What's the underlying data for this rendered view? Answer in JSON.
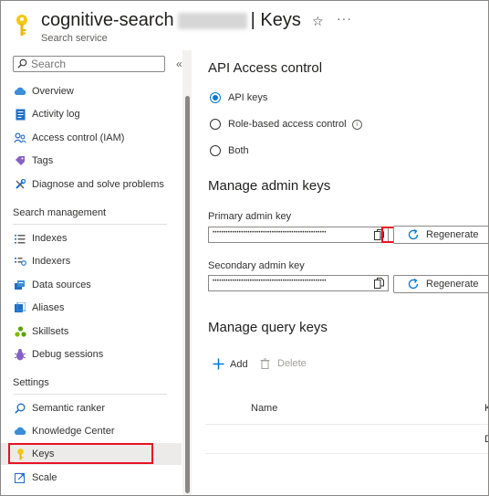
{
  "header": {
    "title_prefix": "cognitive-search",
    "title_suffix": "| Keys",
    "subtitle": "Search service",
    "star_icon": "star-icon",
    "more_icon": "more-icon",
    "more_glyph": "···"
  },
  "sidebar": {
    "search_placeholder": "Search",
    "collapse_glyph": "«",
    "items_top": [
      {
        "label": "Overview",
        "icon": "cloud-icon"
      },
      {
        "label": "Activity log",
        "icon": "activity-log-icon"
      },
      {
        "label": "Access control (IAM)",
        "icon": "people-icon"
      },
      {
        "label": "Tags",
        "icon": "tag-icon"
      },
      {
        "label": "Diagnose and solve problems",
        "icon": "wrench-icon"
      }
    ],
    "section_search_management": "Search management",
    "items_search": [
      {
        "label": "Indexes",
        "icon": "indexes-icon"
      },
      {
        "label": "Indexers",
        "icon": "indexers-icon"
      },
      {
        "label": "Data sources",
        "icon": "data-sources-icon"
      },
      {
        "label": "Aliases",
        "icon": "aliases-icon"
      },
      {
        "label": "Skillsets",
        "icon": "skillsets-icon"
      },
      {
        "label": "Debug sessions",
        "icon": "debug-icon"
      }
    ],
    "section_settings": "Settings",
    "items_settings": [
      {
        "label": "Semantic ranker",
        "icon": "semantic-icon"
      },
      {
        "label": "Knowledge Center",
        "icon": "knowledge-icon"
      },
      {
        "label": "Keys",
        "icon": "key-icon",
        "selected": true
      },
      {
        "label": "Scale",
        "icon": "scale-icon"
      }
    ]
  },
  "main": {
    "api_access_title": "API Access control",
    "radio_options": [
      {
        "label": "API keys",
        "selected": true
      },
      {
        "label": "Role-based access control",
        "selected": false,
        "info": true
      },
      {
        "label": "Both",
        "selected": false
      }
    ],
    "info_glyph": "i",
    "manage_admin_title": "Manage admin keys",
    "primary_label": "Primary admin key",
    "primary_value": "••••••••••••••••••••••••••••••••••••••••••••••••••••",
    "secondary_label": "Secondary admin key",
    "secondary_value": "••••••••••••••••••••••••••••••••••••••••••••••••••••",
    "regenerate_label": "Regenerate",
    "manage_query_title": "Manage query keys",
    "add_label": "Add",
    "delete_label": "Delete",
    "name_column": "Name",
    "cut_column": "K",
    "cut_cell": "D"
  },
  "colors": {
    "accent": "#0078d4",
    "highlight": "#e81123",
    "key_gold": "#f2c811"
  }
}
